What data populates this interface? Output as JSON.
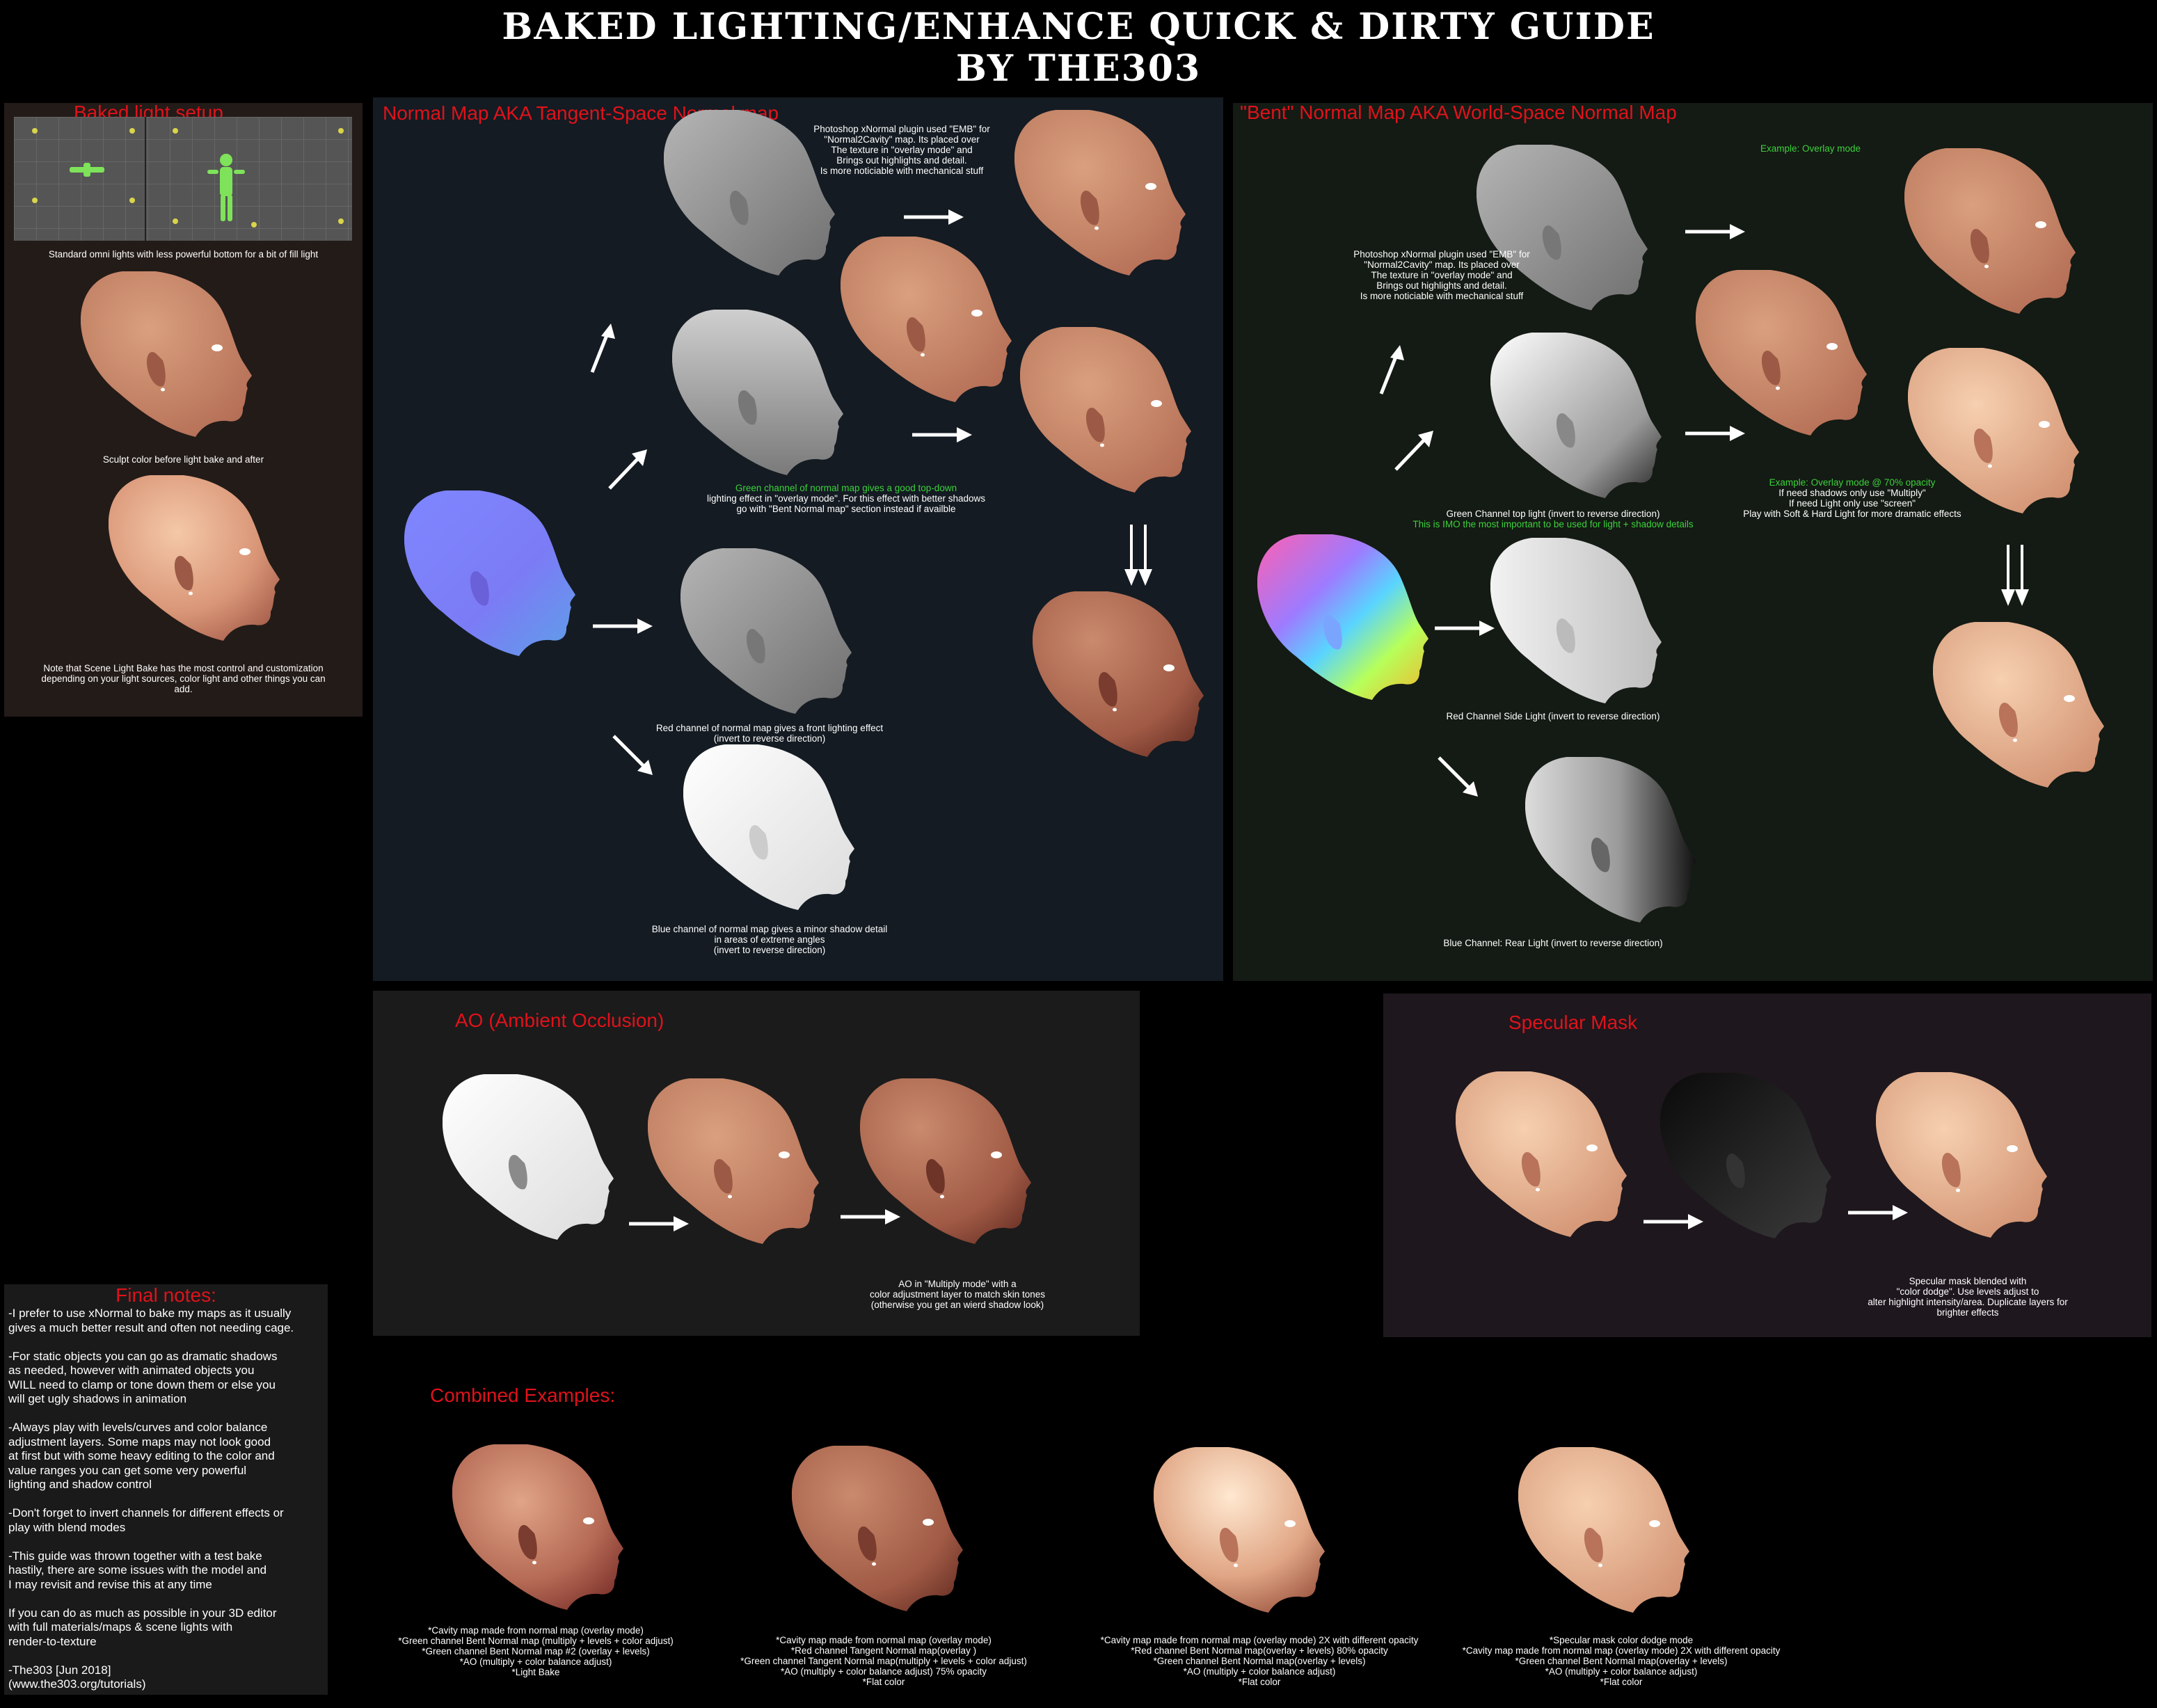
{
  "title": {
    "line1": "BAKED LIGHTING/ENHANCE QUICK & DIRTY GUIDE",
    "line2": "BY THE303"
  },
  "baked": {
    "title": "Baked light setup",
    "cap1": "Standard omni lights with less powerful bottom for a bit of fill light",
    "cap2": "Sculpt color before light bake and after",
    "cap3": "Note that Scene Light Bake has the most control and customization\ndepending on your light sources, color light and other things you can\nadd."
  },
  "normal": {
    "title": "Normal Map AKA Tangent-Space Normal map",
    "cap_emb": "Photoshop xNormal plugin used \"EMB\" for\n\"Normal2Cavity\" map.  Its placed over\nThe texture in \"overlay mode\" and\nBrings out highlights and detail.\nIs more noticiable with mechanical stuff",
    "cap_green_a": "Green channel of normal map gives a good top-down",
    "cap_green_b": "lighting effect in \"overlay mode\".  For this effect with better shadows\ngo with \"Bent Normal map\" section instead if availble",
    "cap_red": "Red channel of normal map gives a front lighting effect\n(invert to reverse direction)",
    "cap_blue": "Blue channel of normal map gives a minor shadow detail\nin areas of extreme angles\n(invert to reverse direction)"
  },
  "bent": {
    "title": "\"Bent\" Normal Map AKA World-Space Normal Map",
    "example1": "Example: Overlay mode",
    "cap_emb": "Photoshop xNormal plugin used \"EMB\" for\n\"Normal2Cavity\" map.  Its placed over\nThe texture in \"overlay mode\" and\nBrings out highlights and detail.\nIs more noticiable with mechanical stuff",
    "cap_green": "Green Channel top light (invert to reverse direction)",
    "cap_green_note": "This is IMO the most important to be used for light + shadow details",
    "example2": "Example: Overlay mode @ 70% opacity",
    "cap_modes": "If need shadows only use \"Multiply\"\nIf need Light only use \"screen\"\nPlay with Soft & Hard Light for more dramatic effects",
    "cap_red": "Red Channel Side Light (invert to reverse direction)",
    "cap_blue": "Blue Channel:  Rear Light (invert to reverse direction)"
  },
  "ao": {
    "title": "AO (Ambient Occlusion)",
    "cap": "AO in \"Multiply mode\" with a\ncolor adjustment layer to match skin tones\n(otherwise you get an wierd shadow look)"
  },
  "spec": {
    "title": "Specular Mask",
    "cap": "Specular mask blended with\n\"color dodge\".  Use levels adjust to\nalter highlight intensity/area.  Duplicate layers for\nbrighter effects"
  },
  "notes": {
    "title": "Final notes:",
    "body": "-I prefer to use xNormal to bake my maps as it usually\ngives a much better result and often not needing cage.\n\n-For static objects you can go as dramatic shadows\nas needed, however with animated objects you\nWILL need to clamp or tone down them or else you\nwill get ugly shadows in animation\n\n-Always play with levels/curves and color balance\nadjustment layers.  Some maps may not look good\nat first but with some heavy editing to the color and\nvalue ranges you can get some very powerful\nlighting and shadow control\n\n-Don't forget to invert channels for different effects or\nplay with blend modes\n\n-This guide was thrown together with a test bake\nhastily, there are some issues with the model and\nI may revisit and revise this at any time\n\nIf you can do as much as possible  in your 3D editor\nwith full materials/maps & scene lights with\nrender-to-texture\n\n-The303  [Jun 2018]\n(www.the303.org/tutorials)"
  },
  "combined": {
    "title": "Combined Examples:",
    "c1": "*Cavity map made from normal map (overlay mode)\n*Green channel Bent Normal map (multiply + levels + color adjust)\n*Green channel Bent Normal map #2 (overlay + levels)\n*AO (multiply + color balance adjust)\n*Light Bake",
    "c2": "*Cavity map made from normal map (overlay mode)\n*Red channel Tangent Normal map(overlay )\n*Green channel Tangent Normal map(multiply + levels + color adjust)\n*AO (multiply + color balance adjust) 75% opacity\n*Flat color",
    "c3": "*Cavity map made from normal map (overlay mode) 2X with different opacity\n*Red channel Bent Normal map(overlay + levels) 80% opacity\n*Green channel Bent Normal map(overlay + levels)\n*AO (multiply + color balance adjust)\n*Flat color",
    "c4": "*Specular mask color dodge mode\n*Cavity map made from normal map (overlay mode) 2X with different opacity\n*Green channel Bent Normal map(overlay + levels)\n*AO (multiply + color balance adjust)\n*Flat color"
  },
  "colors": {
    "accent_red": "#e0121b",
    "accent_green": "#3cd13c",
    "skin": "#d48a6e",
    "skin_light": "#ecb894"
  }
}
